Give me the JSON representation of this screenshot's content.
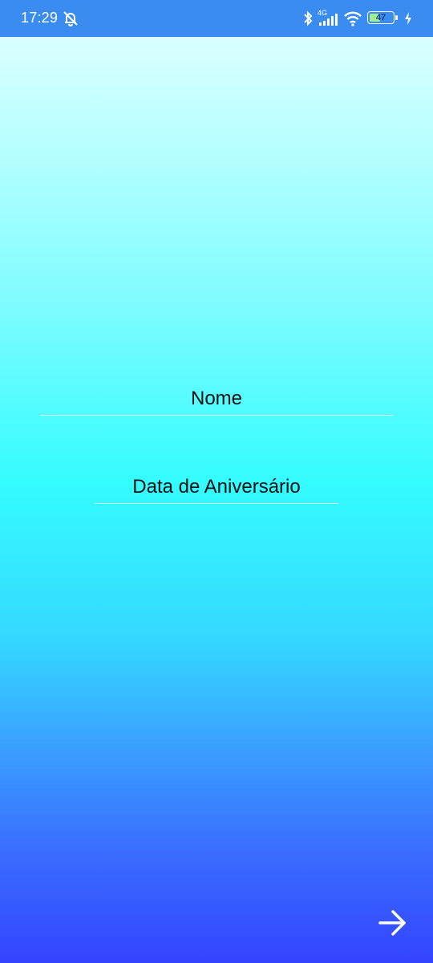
{
  "status_bar": {
    "time": "17:29",
    "network": "4G",
    "battery_percent": "47",
    "battery_level": 0.47,
    "battery_fill_color": "#9ef08e",
    "icons": [
      "alarm-off-icon",
      "bluetooth-icon",
      "signal-icon",
      "wifi-icon",
      "battery-icon",
      "charging-icon"
    ]
  },
  "form": {
    "name_placeholder": "Nome",
    "birthday_placeholder": "Data de Aniversário"
  },
  "next_button": {
    "icon": "arrow-right-icon",
    "color": "#ffffff"
  },
  "colors": {
    "status_bar": "#3a8cf0",
    "gradient_top": "#e6ffff",
    "gradient_middle": "#34fcff",
    "gradient_bottom": "#3344ff"
  }
}
